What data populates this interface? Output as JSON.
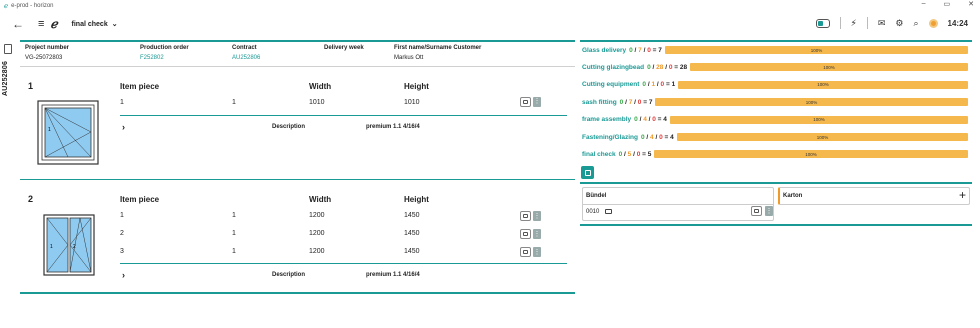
{
  "window": {
    "title": "e-prod - horizon",
    "min": "–",
    "restore": "▭",
    "close": "✕"
  },
  "topbar": {
    "back": "←",
    "menu": "≡",
    "crumb": "final check",
    "crumb_chev": "⌄",
    "time": "14:24"
  },
  "sidebar": {
    "order_vertical": "AU252806"
  },
  "header": {
    "project_number_label": "Project number",
    "project_number": "VG-25072803",
    "production_order_label": "Production order",
    "production_order": "F252802",
    "contract_label": "Contract",
    "contract": "AU252806",
    "delivery_week_label": "Delivery week",
    "delivery_week": "",
    "customer_label": "First name/Surname Customer",
    "customer": "Markus Ott"
  },
  "columns": {
    "item_piece": "Item piece",
    "width": "Width",
    "height": "Height",
    "description": "Description"
  },
  "items": [
    {
      "number": "1",
      "description_value": "premium 1.1  4/16/4",
      "rows": [
        {
          "piece": "1",
          "qty": "1",
          "width": "1010",
          "height": "1010"
        }
      ]
    },
    {
      "number": "2",
      "description_value": "premium 1.1  4/16/4",
      "rows": [
        {
          "piece": "1",
          "qty": "1",
          "width": "1200",
          "height": "1450"
        },
        {
          "piece": "2",
          "qty": "1",
          "width": "1200",
          "height": "1450"
        },
        {
          "piece": "3",
          "qty": "1",
          "width": "1200",
          "height": "1450"
        }
      ]
    }
  ],
  "progress": [
    {
      "label": "Glass delivery",
      "done": "0",
      "open": "7",
      "err": "0",
      "total": "7",
      "percent": "100%",
      "fill": 1.0
    },
    {
      "label": "Cutting glazingbead",
      "done": "0",
      "open": "28",
      "err": "0",
      "total": "28",
      "percent": "100%",
      "fill": 1.0
    },
    {
      "label": "Cutting equipment",
      "done": "0",
      "open": "1",
      "err": "0",
      "total": "1",
      "percent": "100%",
      "fill": 1.0
    },
    {
      "label": "sash fitting",
      "done": "0",
      "open": "7",
      "err": "0",
      "total": "7",
      "percent": "100%",
      "fill": 1.0
    },
    {
      "label": "frame assembly",
      "done": "0",
      "open": "4",
      "err": "0",
      "total": "4",
      "percent": "100%",
      "fill": 1.0
    },
    {
      "label": "Fastening/Glazing",
      "done": "0",
      "open": "4",
      "err": "0",
      "total": "4",
      "percent": "100%",
      "fill": 1.0
    },
    {
      "label": "final check",
      "done": "0",
      "open": "5",
      "err": "0",
      "total": "5",
      "percent": "100%",
      "fill": 1.0
    }
  ],
  "packing": {
    "bundle_label": "Bündel",
    "bundle_value": "0010",
    "carton_label": "Karton",
    "add": "+"
  },
  "colors": {
    "teal": "#1a9a95",
    "bar": "#f5b84c",
    "done": "#3aaa4a",
    "open": "#f09a2a",
    "error": "#e23a3a"
  }
}
